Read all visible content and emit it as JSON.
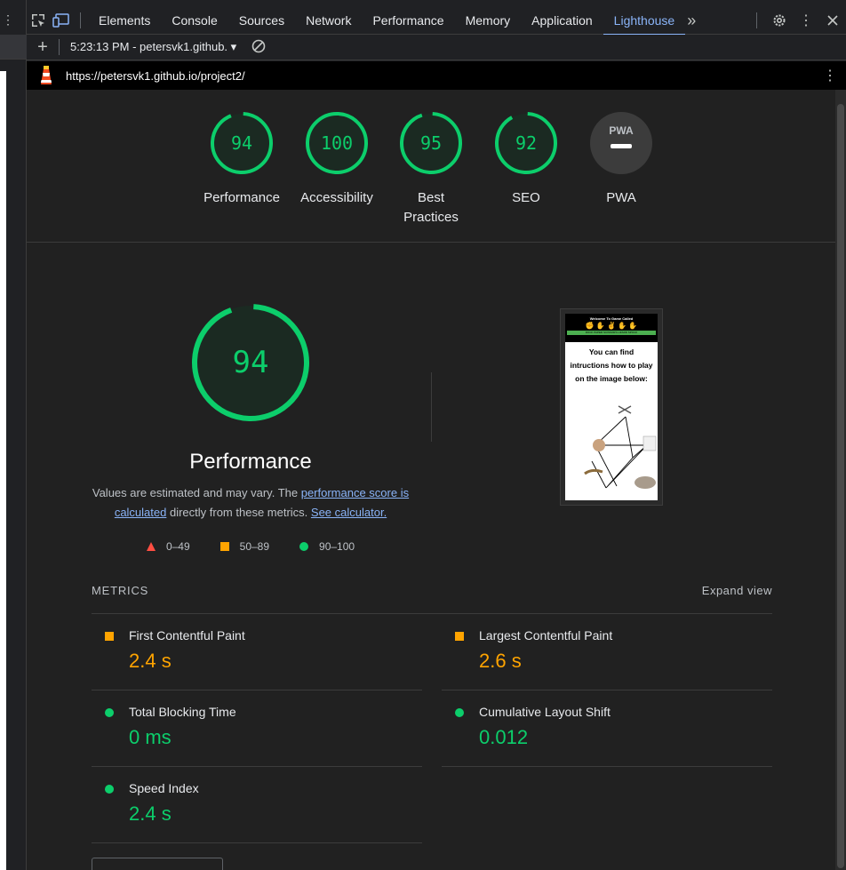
{
  "devtools": {
    "tabs": [
      "Elements",
      "Console",
      "Sources",
      "Network",
      "Performance",
      "Memory",
      "Application",
      "Lighthouse"
    ],
    "active_tab": "Lighthouse",
    "report_selector": "5:23:13 PM - petersvk1.github.",
    "url": "https://petersvk1.github.io/project2/"
  },
  "categories": [
    {
      "label": "Performance",
      "score": "94",
      "score_value": 94
    },
    {
      "label": "Accessibility",
      "score": "100",
      "score_value": 100
    },
    {
      "label": "Best Practices",
      "score": "95",
      "score_value": 95
    },
    {
      "label": "SEO",
      "score": "92",
      "score_value": 92
    },
    {
      "label": "PWA",
      "badge": "PWA"
    }
  ],
  "performance": {
    "score": "94",
    "score_value": 94,
    "title": "Performance",
    "desc_pre": "Values are estimated and may vary. The ",
    "desc_link1": "performance score is calculated",
    "desc_mid": " directly from these metrics. ",
    "desc_link2": "See calculator."
  },
  "legend": {
    "fail": "0–49",
    "average": "50–89",
    "pass": "90–100"
  },
  "screenshot": {
    "header": "Welcome To Game Called",
    "nav": "ROCK PAPER SCISSORS LIZARD SPOCK",
    "text": "You can find intructions how to play on the image below:"
  },
  "metrics": {
    "heading": "METRICS",
    "expand": "Expand view",
    "items": [
      {
        "name": "First Contentful Paint",
        "value": "2.4 s",
        "rating": "average"
      },
      {
        "name": "Largest Contentful Paint",
        "value": "2.6 s",
        "rating": "average"
      },
      {
        "name": "Total Blocking Time",
        "value": "0 ms",
        "rating": "pass"
      },
      {
        "name": "Cumulative Layout Shift",
        "value": "0.012",
        "rating": "pass"
      },
      {
        "name": "Speed Index",
        "value": "2.4 s",
        "rating": "pass"
      }
    ]
  },
  "colors": {
    "pass": "#0cce6b",
    "average": "#ffa400",
    "fail": "#ff4e42",
    "link": "#8ab4f8"
  }
}
